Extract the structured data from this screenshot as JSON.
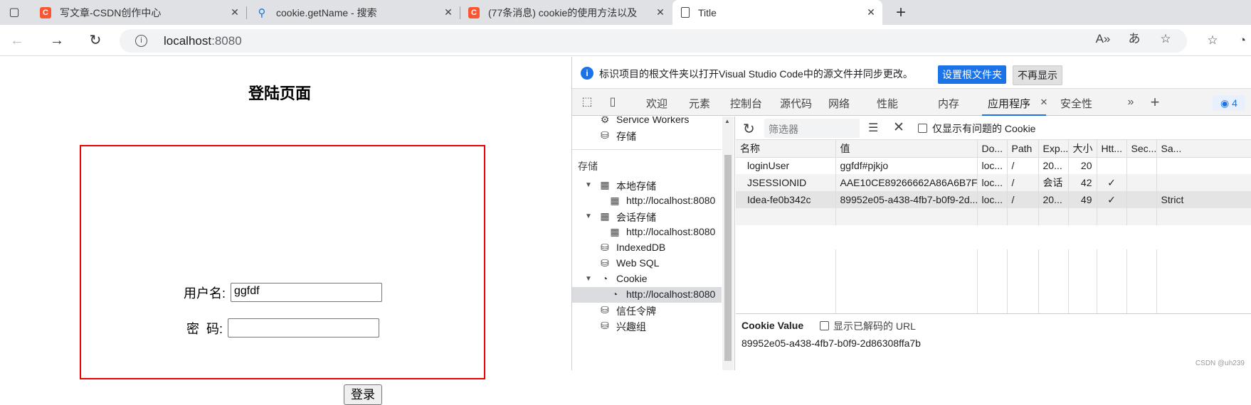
{
  "tabs": [
    {
      "title": "写文章-CSDN创作中心",
      "icon": "csdn-icon"
    },
    {
      "title": "cookie.getName - 搜索",
      "icon": "search-icon"
    },
    {
      "title": "(77条消息) cookie的使用方法以及",
      "icon": "csdn-icon"
    },
    {
      "title": "Title",
      "icon": "page-icon"
    }
  ],
  "address": {
    "host": "localhost",
    "port": ":8080"
  },
  "page": {
    "title": "登陆页面",
    "username_label": "用户名:",
    "username_value": "ggfdf",
    "password_label": "密  码:",
    "password_value": "",
    "login_label": "登录"
  },
  "devtools": {
    "info_message": "标识项目的根文件夹以打开Visual Studio Code中的源文件并同步更改。",
    "set_root_label": "设置根文件夹",
    "dismiss_label": "不再显示",
    "tabs": [
      "欢迎",
      "元素",
      "控制台",
      "源代码",
      "网络",
      "性能",
      "内存",
      "应用程序",
      "安全性"
    ],
    "issues_count": "4",
    "sidebar": {
      "service_workers": "Service Workers",
      "storage_item": "存储",
      "group_storage": "存储",
      "local_storage": "本地存储",
      "local_origin": "http://localhost:8080",
      "session_storage": "会话存储",
      "session_origin": "http://localhost:8080",
      "indexeddb": "IndexedDB",
      "websql": "Web SQL",
      "cookie": "Cookie",
      "cookie_origin": "http://localhost:8080",
      "trust_tokens": "信任令牌",
      "interest_groups": "兴趣组"
    },
    "filter_placeholder": "筛选器",
    "only_issues_label": "仅显示有问题的 Cookie",
    "columns": [
      "名称",
      "值",
      "Do...",
      "Path",
      "Exp...",
      "大小",
      "Htt...",
      "Sec...",
      "Sa..."
    ],
    "rows": [
      [
        "loginUser",
        "ggfdf#pjkjo",
        "loc...",
        "/",
        "20...",
        "20",
        "",
        "",
        ""
      ],
      [
        "JSESSIONID",
        "AAE10CE89266662A86A6B7F...",
        "loc...",
        "/",
        "会话",
        "42",
        "✓",
        "",
        ""
      ],
      [
        "Idea-fe0b342c",
        "89952e05-a438-4fb7-b0f9-2d...",
        "loc...",
        "/",
        "20...",
        "49",
        "✓",
        "",
        "Strict"
      ]
    ],
    "cookie_value_title": "Cookie Value",
    "show_decoded_label": "显示已解码的 URL",
    "cookie_value": "89952e05-a438-4fb7-b0f9-2d86308ffa7b"
  },
  "watermark": "CSDN @uh239"
}
